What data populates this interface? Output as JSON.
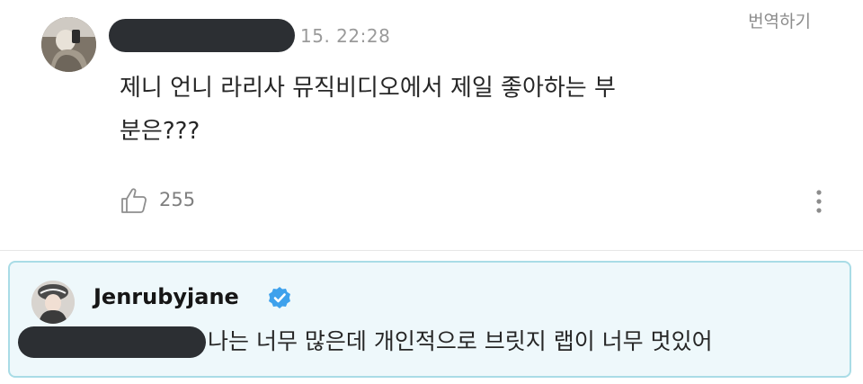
{
  "comment": {
    "timestamp": "15. 22:28",
    "translate_label": "번역하기",
    "text": "제니 언니 라리사 뮤직비디오에서 제일 좋아하는 부\n분은???",
    "like_count": "255"
  },
  "reply": {
    "author": "Jenrubyjane",
    "verified": true,
    "text": "나는 너무 많은데 개인적으로 브릿지 랩이 너무 멋있어"
  },
  "colors": {
    "reply_background": "#eef8fb",
    "reply_border": "#a9dce6",
    "verified_badge": "#3ea1ec",
    "redaction": "#2c2f33",
    "muted_text": "#9a9a9a"
  },
  "icons": {
    "like": "thumbs-up-icon",
    "more": "vertical-ellipsis-icon",
    "verified": "verified-badge-icon"
  }
}
